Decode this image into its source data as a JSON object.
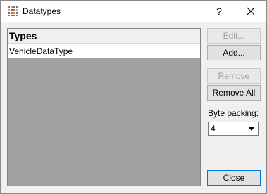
{
  "window": {
    "title": "Datatypes",
    "help_label": "?",
    "app_icon": "grid-icon",
    "close_icon": "close-icon"
  },
  "types": {
    "header": "Types",
    "items": [
      "VehicleDataType"
    ]
  },
  "buttons": {
    "edit": "Edit...",
    "add": "Add...",
    "remove": "Remove",
    "remove_all": "Remove All",
    "close": "Close"
  },
  "byte_packing": {
    "label": "Byte packing:",
    "value": "4"
  }
}
